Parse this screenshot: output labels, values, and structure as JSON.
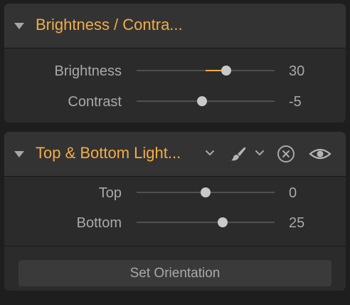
{
  "panels": [
    {
      "title": "Brightness / Contra...",
      "rows": [
        {
          "label": "Brightness",
          "value": "30",
          "fraction": 0.65,
          "fill_from": 0.5
        },
        {
          "label": "Contrast",
          "value": "-5",
          "fraction": 0.475
        }
      ]
    },
    {
      "title": "Top & Bottom Light...",
      "icons": [
        "chevron-down-icon",
        "brush-icon",
        "chevron-down-icon",
        "close-circle-icon",
        "eye-icon"
      ],
      "rows": [
        {
          "label": "Top",
          "value": "0",
          "fraction": 0.5
        },
        {
          "label": "Bottom",
          "value": "25",
          "fraction": 0.625
        }
      ],
      "button": {
        "label": "Set Orientation"
      }
    }
  ],
  "colors": {
    "accent": "#f0ad48",
    "panel": "#2b2b2b",
    "header": "#333333",
    "text": "#a9a9a9",
    "thumb": "#c9c9c9"
  }
}
